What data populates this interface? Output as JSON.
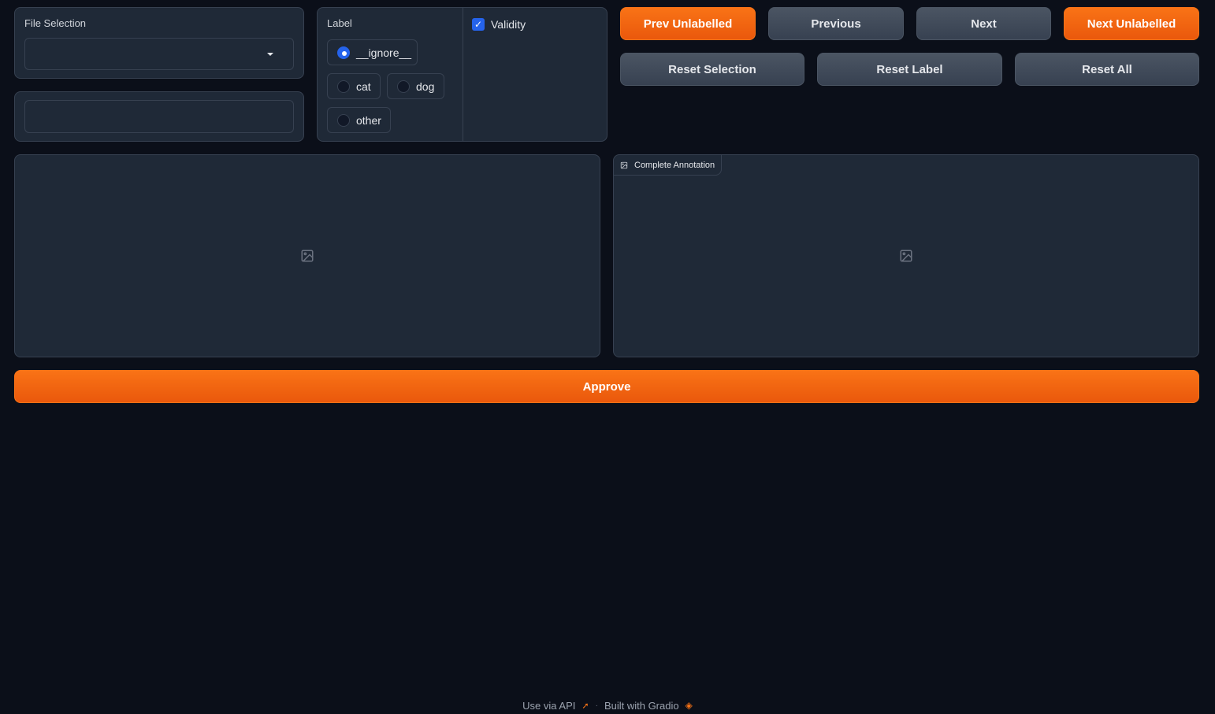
{
  "file_selection": {
    "label": "File Selection",
    "value": ""
  },
  "text_field": {
    "value": ""
  },
  "label_group": {
    "label": "Label",
    "options": [
      "__ignore__",
      "cat",
      "dog",
      "other"
    ],
    "selected": "__ignore__"
  },
  "validity": {
    "label": "Validity",
    "checked": true
  },
  "buttons": {
    "prev_unlabelled": "Prev Unlabelled",
    "previous": "Previous",
    "next": "Next",
    "next_unlabelled": "Next Unlabelled",
    "reset_selection": "Reset Selection",
    "reset_label": "Reset Label",
    "reset_all": "Reset All",
    "approve": "Approve"
  },
  "images": {
    "right_tag": "Complete Annotation"
  },
  "footer": {
    "use_api": "Use via API",
    "built_with": "Built with Gradio"
  },
  "colors": {
    "primary": "#f97316",
    "background": "#0b0f19",
    "panel": "#1f2937",
    "accent": "#2563eb"
  }
}
